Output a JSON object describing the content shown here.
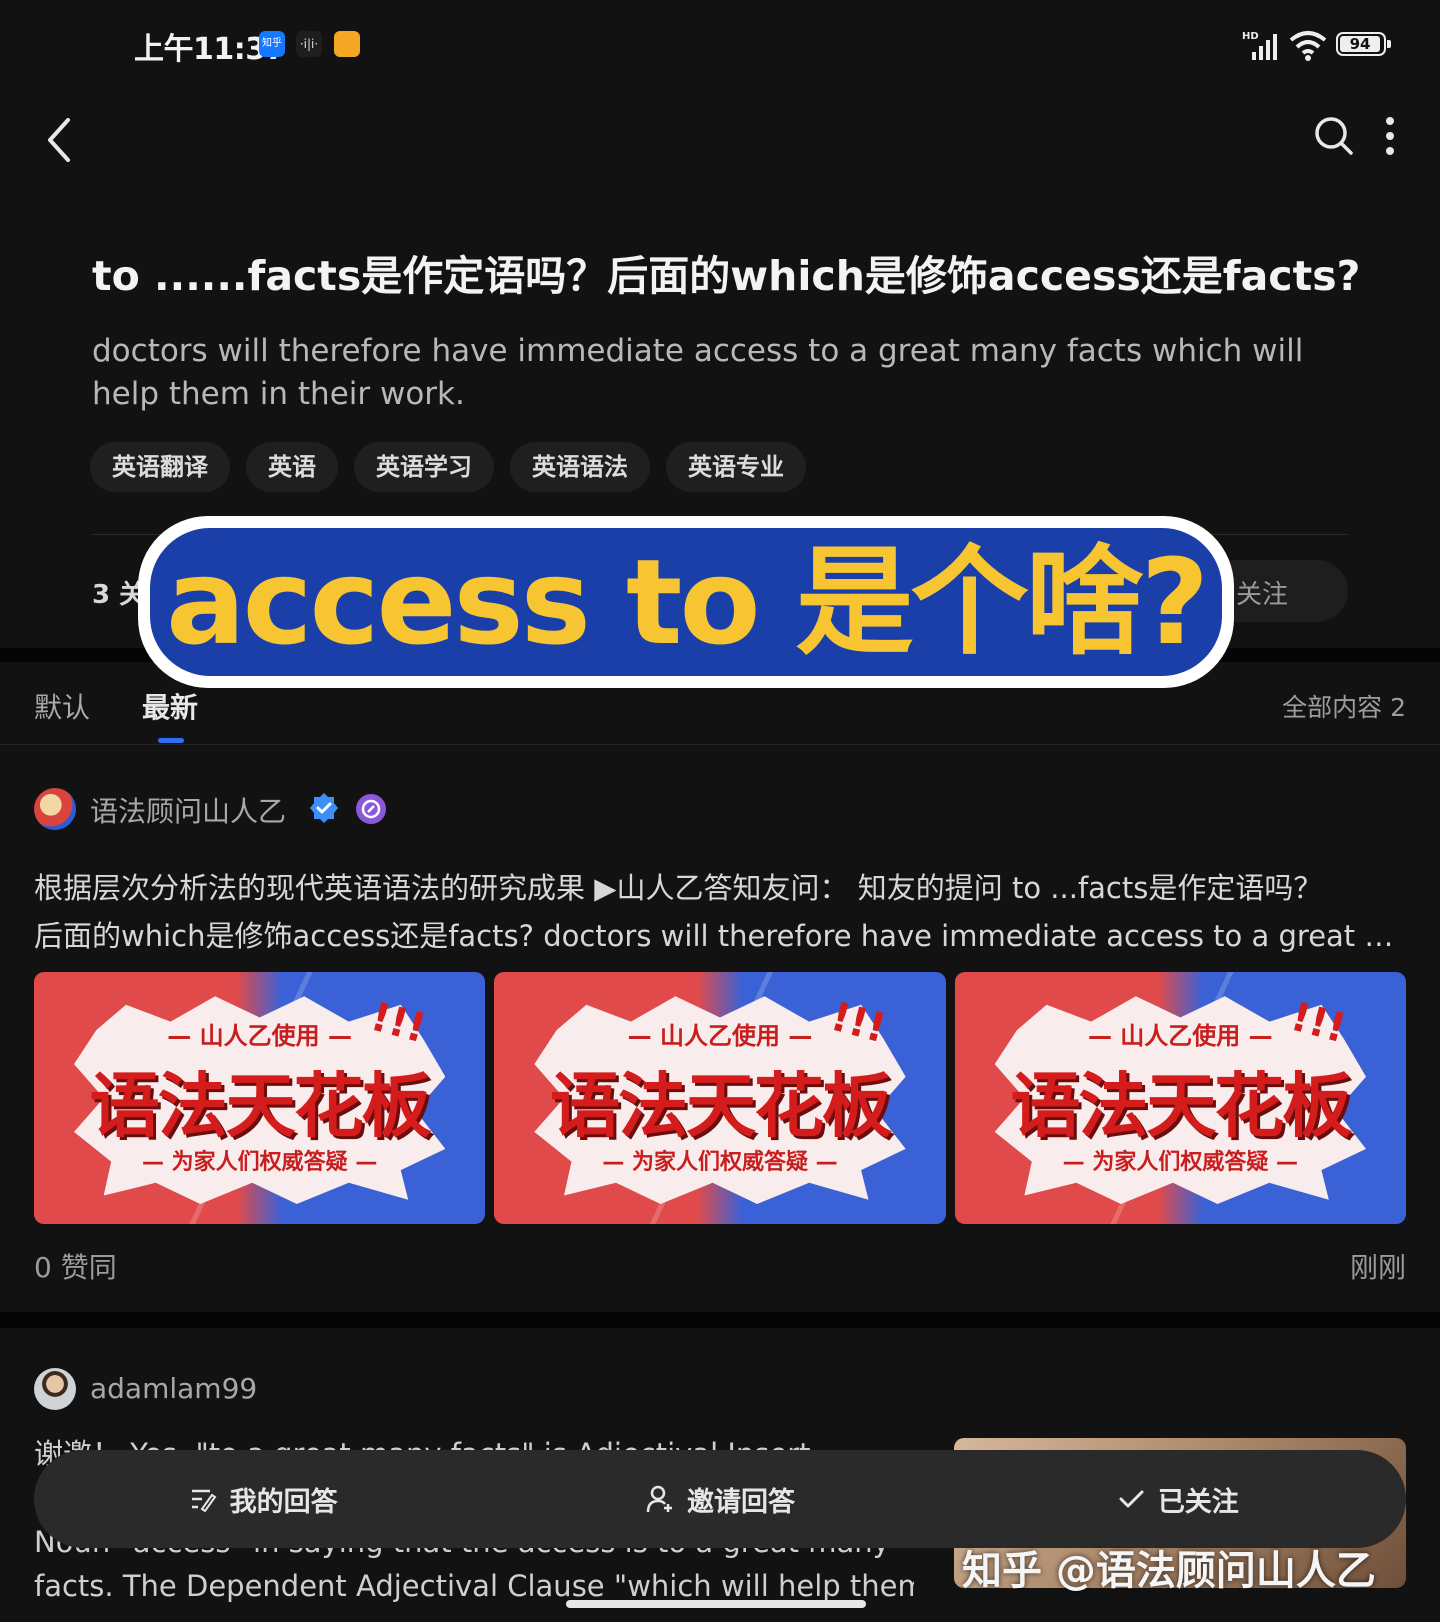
{
  "status_bar": {
    "time": "上午11:37",
    "apps": [
      "知乎",
      "·i|i·",
      ""
    ],
    "battery": "94",
    "network": "HD"
  },
  "nav": {
    "back_icon": "chevron-left-icon",
    "search_icon": "search-icon",
    "more_icon": "more-vertical-icon"
  },
  "question": {
    "title": "to ......facts是作定语吗？后面的which是修饰access还是facts?",
    "description": "doctors will therefore have immediate access to a great many facts which will help them in their work.",
    "tags": [
      "英语翻译",
      "英语",
      "英语学习",
      "英语语法",
      "英语专业"
    ],
    "meta_partial": "3 关",
    "follow_partial": "关注"
  },
  "banner": {
    "text": "access to 是个啥?"
  },
  "sort": {
    "tabs": [
      "默认",
      "最新"
    ],
    "active": "最新",
    "total": "全部内容 2"
  },
  "answers": [
    {
      "author": "语法顾问山人乙",
      "excerpt_line1": "根据层次分析法的现代英语语法的研究成果 ▶山人乙答知友问：  知友的提问 to ...facts是作定语吗？",
      "excerpt_line2": "后面的which是修饰access还是facts? doctors will therefore have immediate access to a great …",
      "thumbnail": {
        "top": "— 山人乙使用 —",
        "main": "语法天花板",
        "sub": "— 为家人们权威答疑 —",
        "bangs": "!!!"
      },
      "upvotes": "0 赞同",
      "time": "刚刚"
    },
    {
      "author": "adamlam99",
      "excerpt_line1": "谢邀！ Yes. \"to a great many facts\" is Adjectival Insert",
      "excerpt_line2": "",
      "excerpt_line3": "Noun \"access\" in saying that the access is to a great many",
      "excerpt_line4": "facts. The Dependent Adjectival Clause \"which will help them"
    }
  ],
  "action_bar": {
    "my_answer": "我的回答",
    "invite": "邀请回答",
    "followed": "已关注"
  },
  "watermark": "知乎 @语法顾问山人乙"
}
